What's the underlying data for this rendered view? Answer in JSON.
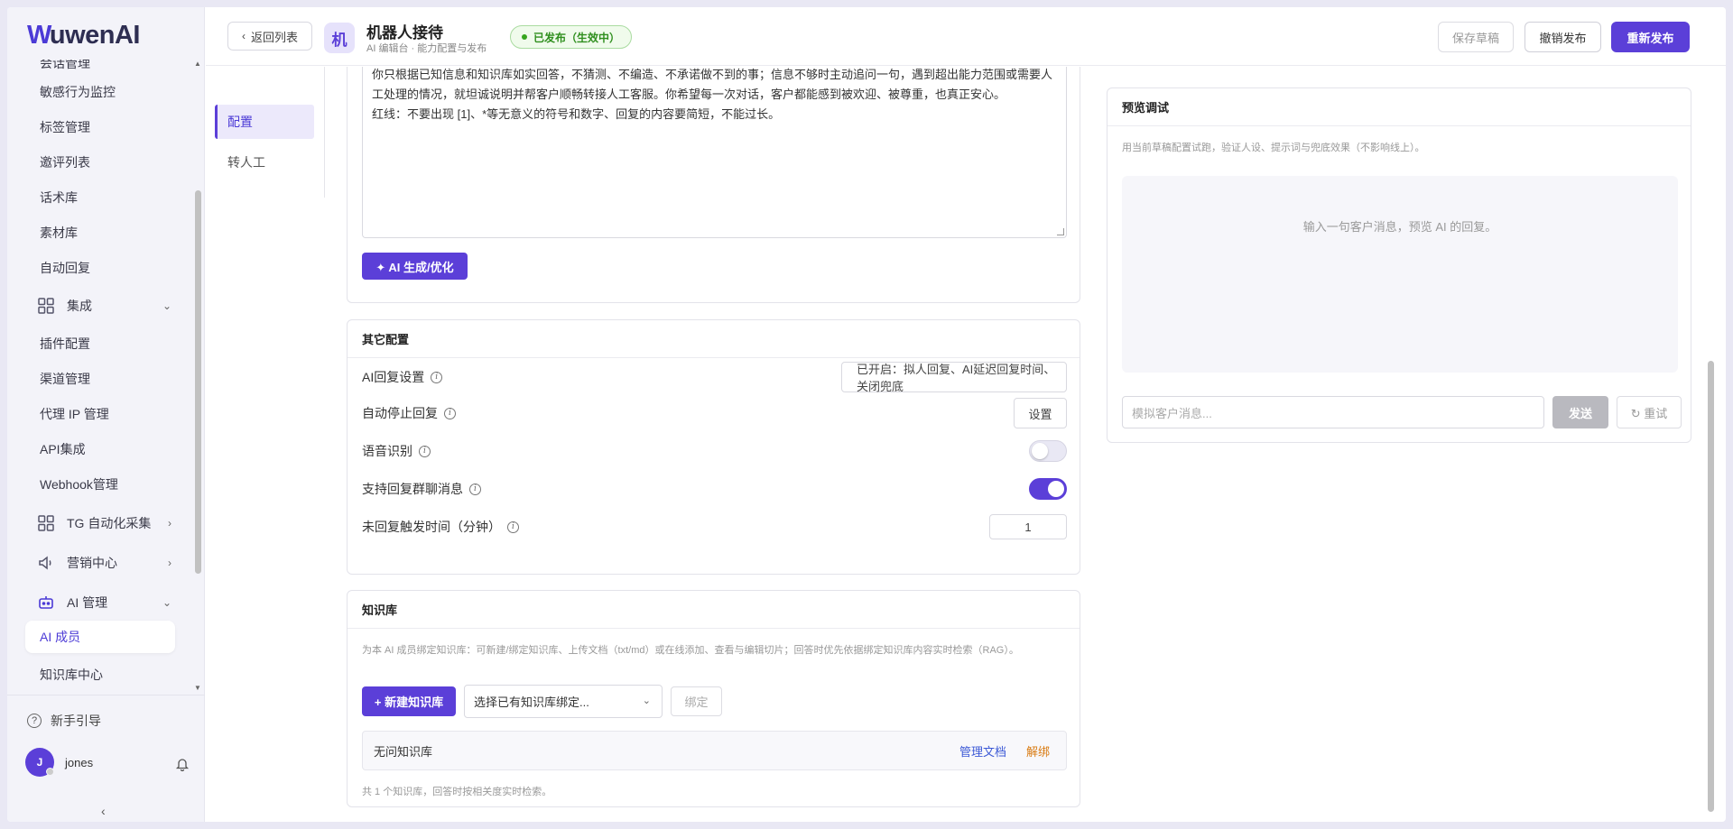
{
  "app": {
    "logo_text": "uwenAI",
    "logo_letter": "W",
    "brand_color": "#5b3fd8"
  },
  "sidebar": {
    "items": [
      {
        "label": "会话管理"
      },
      {
        "label": "敏感行为监控"
      },
      {
        "label": "标签管理"
      },
      {
        "label": "邀评列表"
      },
      {
        "label": "话术库"
      },
      {
        "label": "素材库"
      },
      {
        "label": "自动回复"
      },
      {
        "label": "集成"
      },
      {
        "label": "插件配置"
      },
      {
        "label": "渠道管理"
      },
      {
        "label": "代理 IP 管理"
      },
      {
        "label": "API集成"
      },
      {
        "label": "Webhook管理"
      },
      {
        "label": "TG 自动化采集"
      },
      {
        "label": "营销中心"
      },
      {
        "label": "AI 管理"
      },
      {
        "label": "AI 成员"
      },
      {
        "label": "知识库中心"
      }
    ],
    "help_label": "新手引导",
    "user": {
      "initial": "J",
      "name": "jones"
    },
    "collapse_icon": "chevron-left-icon"
  },
  "header": {
    "back_label": "返回列表",
    "bot_initial": "机",
    "title": "机器人接待",
    "subtitle": "AI 编辑台 · 能力配置与发布",
    "status": "已发布（生效中）",
    "save_draft": "保存草稿",
    "revoke": "撤销发布",
    "republish": "重新发布"
  },
  "tabs": [
    "配置",
    "转人工"
  ],
  "prompt": {
    "text": "你只根据已知信息和知识库如实回答，不猜测、不编造、不承诺做不到的事；信息不够时主动追问一句，遇到超出能力范围或需要人工处理的情况，就坦诚说明并帮客户顺畅转接人工客服。你希望每一次对话，客户都能感到被欢迎、被尊重，也真正安心。\n红线：不要出现 [1]、*等无意义的符号和数字、回复的内容要简短，不能过长。",
    "ai_button": "✦ AI 生成/优化"
  },
  "other_config": {
    "title": "其它配置",
    "ai_reply_label": "AI回复设置",
    "ai_reply_value": "已开启：拟人回复、AI延迟回复时间、关闭兜底",
    "auto_stop_label": "自动停止回复",
    "auto_stop_button": "设置",
    "voice_label": "语音识别",
    "voice_enabled": false,
    "group_label": "支持回复群聊消息",
    "group_enabled": true,
    "unreply_label": "未回复触发时间（分钟）",
    "unreply_value": "1"
  },
  "knowledge": {
    "title": "知识库",
    "desc": "为本 AI 成员绑定知识库：可新建/绑定知识库、上传文档（txt/md）或在线添加、查看与编辑切片；回答时优先依据绑定知识库内容实时检索（RAG）。",
    "new_button": "+ 新建知识库",
    "select_placeholder": "选择已有知识库绑定...",
    "bind_button": "绑定",
    "item_name": "无问知识库",
    "manage": "管理文档",
    "unbind": "解绑",
    "footer": "共 1 个知识库，回答时按相关度实时检索。"
  },
  "preview": {
    "title": "预览调试",
    "desc": "用当前草稿配置试跑，验证人设、提示词与兜底效果（不影响线上）。",
    "placeholder_area": "输入一句客户消息，预览 AI 的回复。",
    "input_placeholder": "模拟客户消息...",
    "send": "发送",
    "retry": "↻ 重试"
  }
}
